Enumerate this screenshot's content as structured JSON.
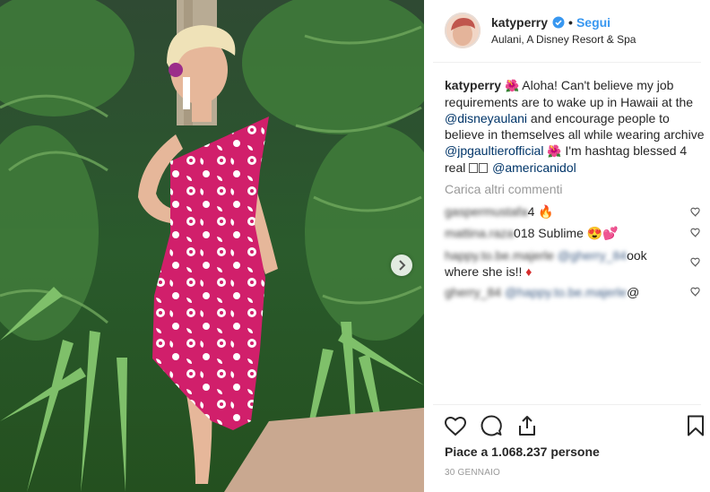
{
  "post": {
    "author": "katyperry",
    "follow_label": "Segui",
    "dot": "•",
    "location": "Aulani, A Disney Resort & Spa"
  },
  "caption": {
    "author": "katyperry",
    "emoji_1": "🌺",
    "text_1": " Aloha! Can't believe my job requirements are to wake up in Hawaii at the ",
    "mention_1": "@disneyaulani",
    "text_2": " and encourage people to believe in themselves all while wearing archive ",
    "mention_2": "@jpgaultierofficial",
    "emoji_2": "🌺",
    "text_3": " I'm hashtag blessed 4 real ",
    "mention_3": "@americanidol"
  },
  "more_comments_label": "Carica altri commenti",
  "comments": [
    {
      "user_blurred": "gaspermustafa",
      "text_visible": "4",
      "emoji": "🔥"
    },
    {
      "user_blurred": "mattina.raza",
      "text_visible": "018 Sublime",
      "emoji": "😍💕"
    },
    {
      "user_blurred": "happy.to.be.majerle",
      "mention_blurred": "@gherry_84",
      "text_visible": "ook",
      "text_line2": "where she is!!",
      "emoji": "♦"
    },
    {
      "user_blurred": "gherry_84",
      "mention_blurred": "@happy.to.be.majerle",
      "text_visible": "@"
    }
  ],
  "likes_label": "Piace a 1.068.237 persone",
  "date_label": "30 GENNAIO",
  "colors": {
    "accent": "#3897f0",
    "mention": "#003569",
    "muted": "#999999",
    "dress": "#d11f6b"
  },
  "icons": [
    "verified-badge-icon",
    "heart-icon",
    "comment-icon",
    "share-icon",
    "bookmark-icon",
    "chevron-right-icon"
  ]
}
